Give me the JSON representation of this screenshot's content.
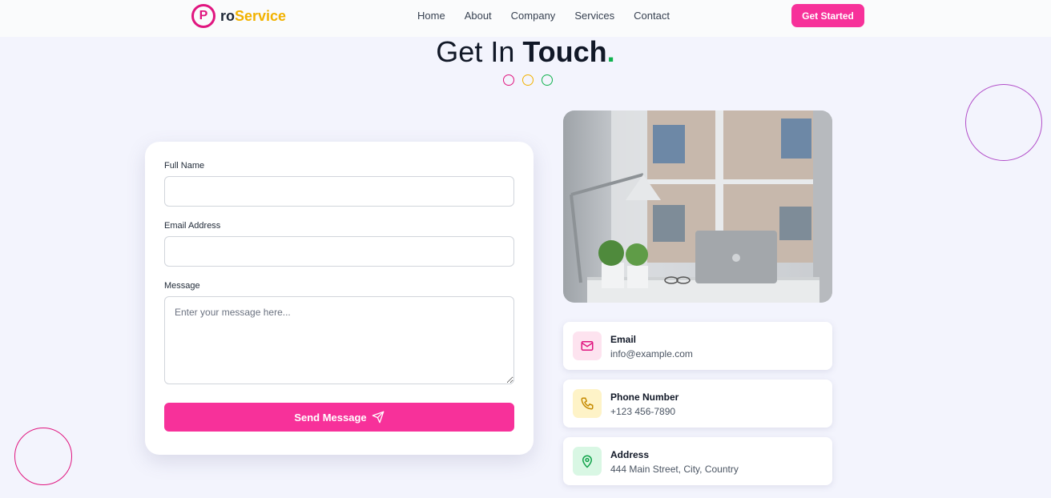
{
  "nav": {
    "logo_letter": "P",
    "logo_part1": "ro",
    "logo_part2": "Service",
    "links": [
      "Home",
      "About",
      "Company",
      "Services",
      "Contact"
    ],
    "cta": "Get Started"
  },
  "heading": {
    "part1": "Get In ",
    "part2": "Touch",
    "dot": "."
  },
  "form": {
    "name_label": "Full Name",
    "name_value": "",
    "email_label": "Email Address",
    "email_value": "",
    "message_label": "Message",
    "message_placeholder": "Enter your message here...",
    "send_label": "Send Message"
  },
  "contact": [
    {
      "title": "Email",
      "value": "info@example.com",
      "icon": "mail-icon"
    },
    {
      "title": "Phone Number",
      "value": "+123 456-7890",
      "icon": "phone-icon"
    },
    {
      "title": "Address",
      "value": "444 Main Street, City, Country",
      "icon": "map-pin-icon"
    }
  ],
  "colors": {
    "brand_pink": "#f7319a",
    "brand_yellow": "#f2b200",
    "brand_green": "#10b24e"
  }
}
